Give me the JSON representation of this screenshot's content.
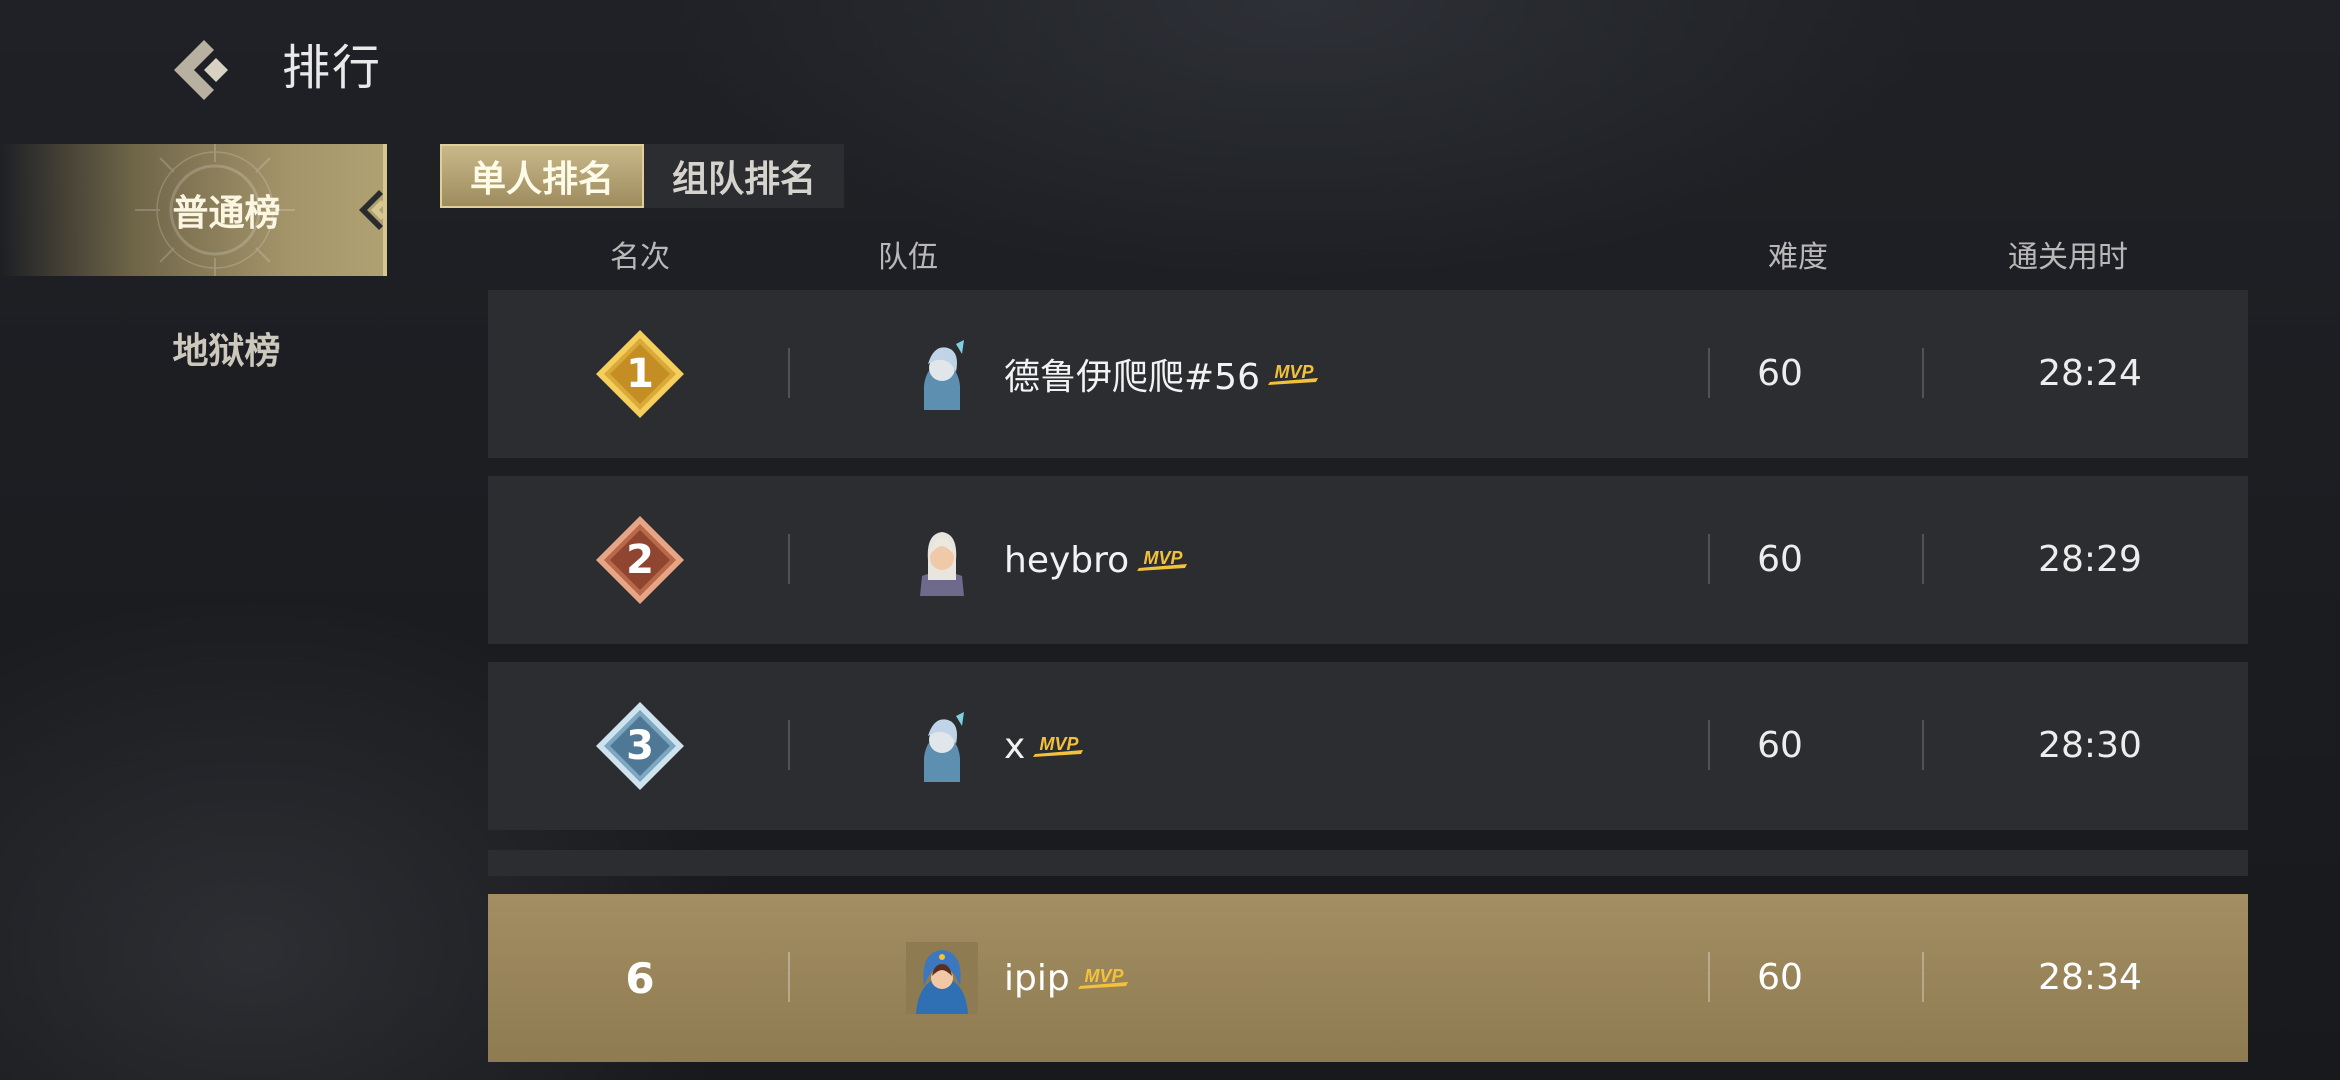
{
  "header": {
    "title": "排行"
  },
  "sidebar": {
    "items": [
      {
        "label": "普通榜"
      },
      {
        "label": "地狱榜"
      }
    ]
  },
  "tabs": [
    {
      "label": "单人排名"
    },
    {
      "label": "组队排名"
    }
  ],
  "columns": {
    "rank": "名次",
    "team": "队伍",
    "difficulty": "难度",
    "time": "通关用时"
  },
  "rows": [
    {
      "rank": "1",
      "name": "德鲁伊爬爬#56",
      "badge": "MVP",
      "difficulty": "60",
      "time": "28:24"
    },
    {
      "rank": "2",
      "name": "heybro",
      "badge": "MVP",
      "difficulty": "60",
      "time": "28:29"
    },
    {
      "rank": "3",
      "name": "x",
      "badge": "MVP",
      "difficulty": "60",
      "time": "28:30"
    }
  ],
  "my_row": {
    "rank": "6",
    "name": "ipip",
    "badge": "MVP",
    "difficulty": "60",
    "time": "28:34"
  },
  "colors": {
    "gold": "#d9a93a",
    "bronze": "#a2553a",
    "silver_blue": "#5b86a5",
    "highlight": "#a38e63",
    "active_tab": "#c9b88a"
  },
  "icons": {
    "back": "back-arrow-icon",
    "rank1": "gold-diamond-icon",
    "rank2": "bronze-diamond-icon",
    "rank3": "blue-diamond-icon",
    "mvp": "mvp-badge-icon"
  }
}
